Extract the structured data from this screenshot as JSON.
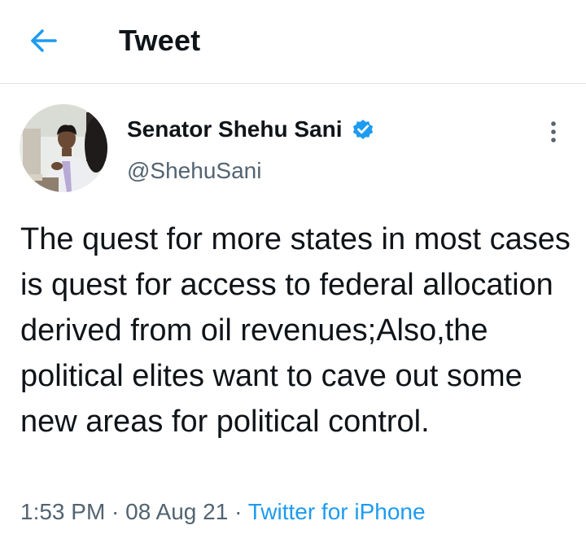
{
  "header": {
    "back_icon": "arrow-left-icon",
    "title": "Tweet"
  },
  "tweet": {
    "author": {
      "name": "Senator Shehu Sani",
      "handle": "@ShehuSani",
      "verified": true,
      "verified_icon": "verified-badge-icon"
    },
    "more_icon": "more-vertical-icon",
    "text": "The quest for more states in most cases is quest for access to federal allocation derived from oil revenues;Also,the political elites want to cave out some new areas for political control.",
    "time": "1:53 PM",
    "date": "08 Aug 21",
    "separator": " · ",
    "source": "Twitter for iPhone"
  },
  "colors": {
    "accent": "#1d9bf0",
    "text_primary": "#0f1419",
    "text_secondary": "#536471",
    "divider": "#dfe3e6"
  }
}
